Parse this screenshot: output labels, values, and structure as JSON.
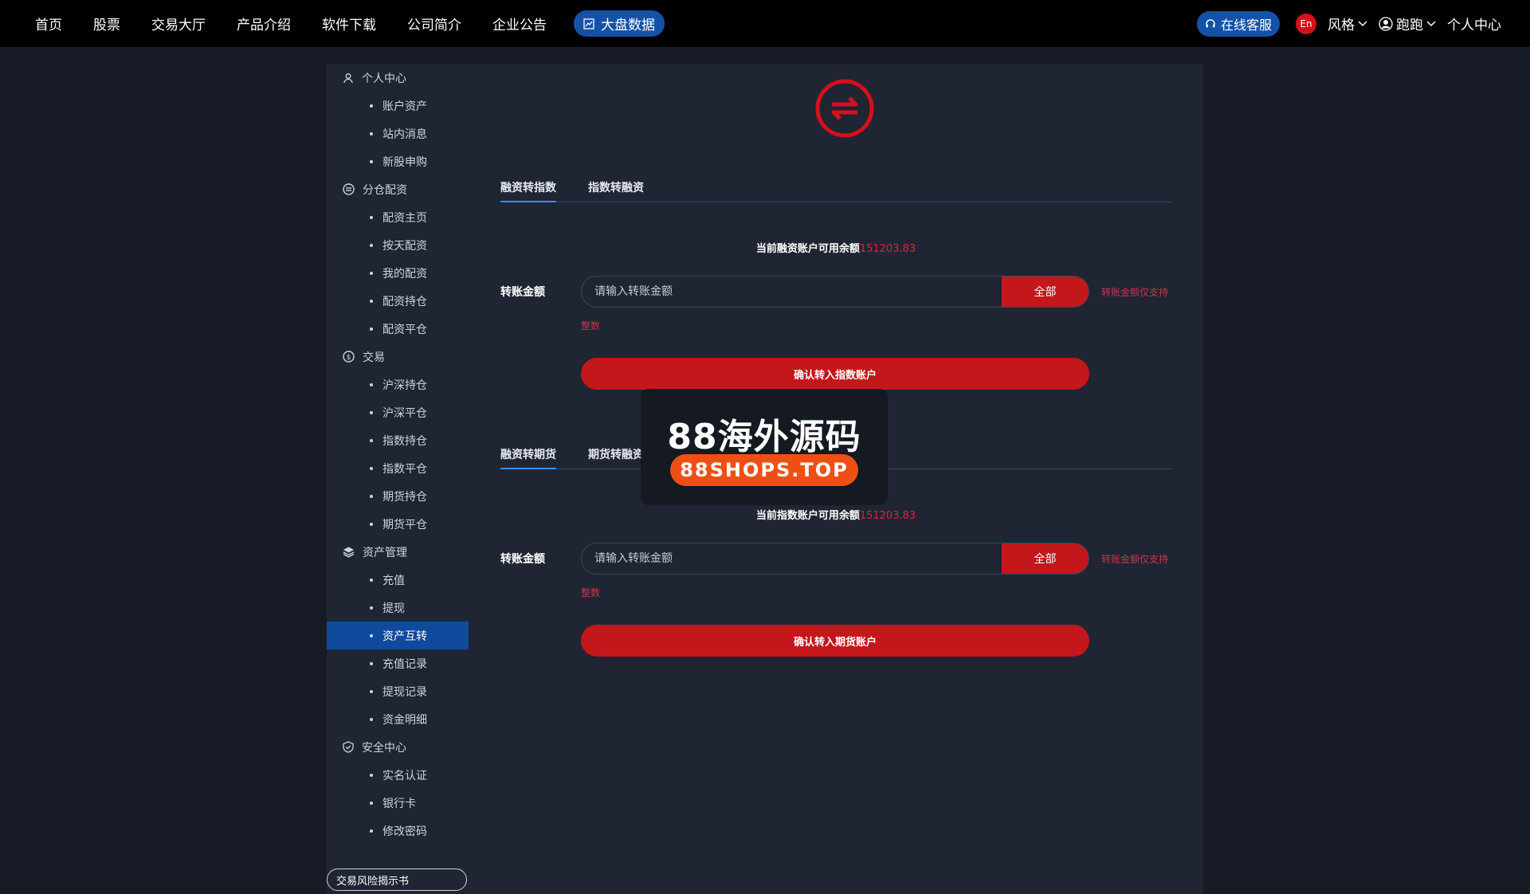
{
  "nav": {
    "items": [
      "首页",
      "股票",
      "交易大厅",
      "产品介绍",
      "软件下载",
      "公司简介",
      "企业公告"
    ],
    "market_data": "大盘数据"
  },
  "topright": {
    "service": "在线客服",
    "lang": "En",
    "style": "风格",
    "user": "跑跑",
    "center": "个人中心"
  },
  "sidebar": {
    "groups": [
      {
        "label": "个人中心",
        "icon": "user-icon",
        "items": [
          "账户资产",
          "站内消息",
          "新股申购"
        ]
      },
      {
        "label": "分仓配资",
        "icon": "allocation-icon",
        "items": [
          "配资主页",
          "按天配资",
          "我的配资",
          "配资持仓",
          "配资平仓"
        ]
      },
      {
        "label": "交易",
        "icon": "trade-icon",
        "items": [
          "沪深持仓",
          "沪深平仓",
          "指数持仓",
          "指数平仓",
          "期货持仓",
          "期货平仓"
        ]
      },
      {
        "label": "资产管理",
        "icon": "layers-icon",
        "items": [
          "充值",
          "提现",
          "资产互转",
          "充值记录",
          "提现记录",
          "资金明细"
        ]
      },
      {
        "label": "安全中心",
        "icon": "shield-icon",
        "items": [
          "实名认证",
          "银行卡",
          "修改密码"
        ]
      }
    ],
    "active_item": "资产互转",
    "risk_button": "交易风险揭示书"
  },
  "section1": {
    "tabs": [
      "融资转指数",
      "指数转融资"
    ],
    "active_tab": 0,
    "balance_label": "当前融资账户可用余额",
    "balance_value": "151203.83",
    "amount_label": "转账金额",
    "placeholder": "请输入转账金额",
    "all_button": "全部",
    "hint_right": "转账金额仅支持",
    "hint_below": "整数",
    "confirm": "确认转入指数账户"
  },
  "section2": {
    "tabs": [
      "融资转期货",
      "期货转融资"
    ],
    "active_tab": 0,
    "balance_label": "当前指数账户可用余额",
    "balance_value": "151203.83",
    "amount_label": "转账金额",
    "placeholder": "请输入转账金额",
    "all_button": "全部",
    "hint_right": "转账金额仅支持",
    "hint_below": "整数",
    "confirm": "确认转入期货账户"
  },
  "watermark": {
    "title": "88海外源码",
    "domain": "88SHOPS.TOP"
  },
  "colors": {
    "accent_red": "#c3171b",
    "accent_blue": "#1452a8",
    "hint_red": "#c9354d",
    "panel_bg": "#1f2533"
  }
}
